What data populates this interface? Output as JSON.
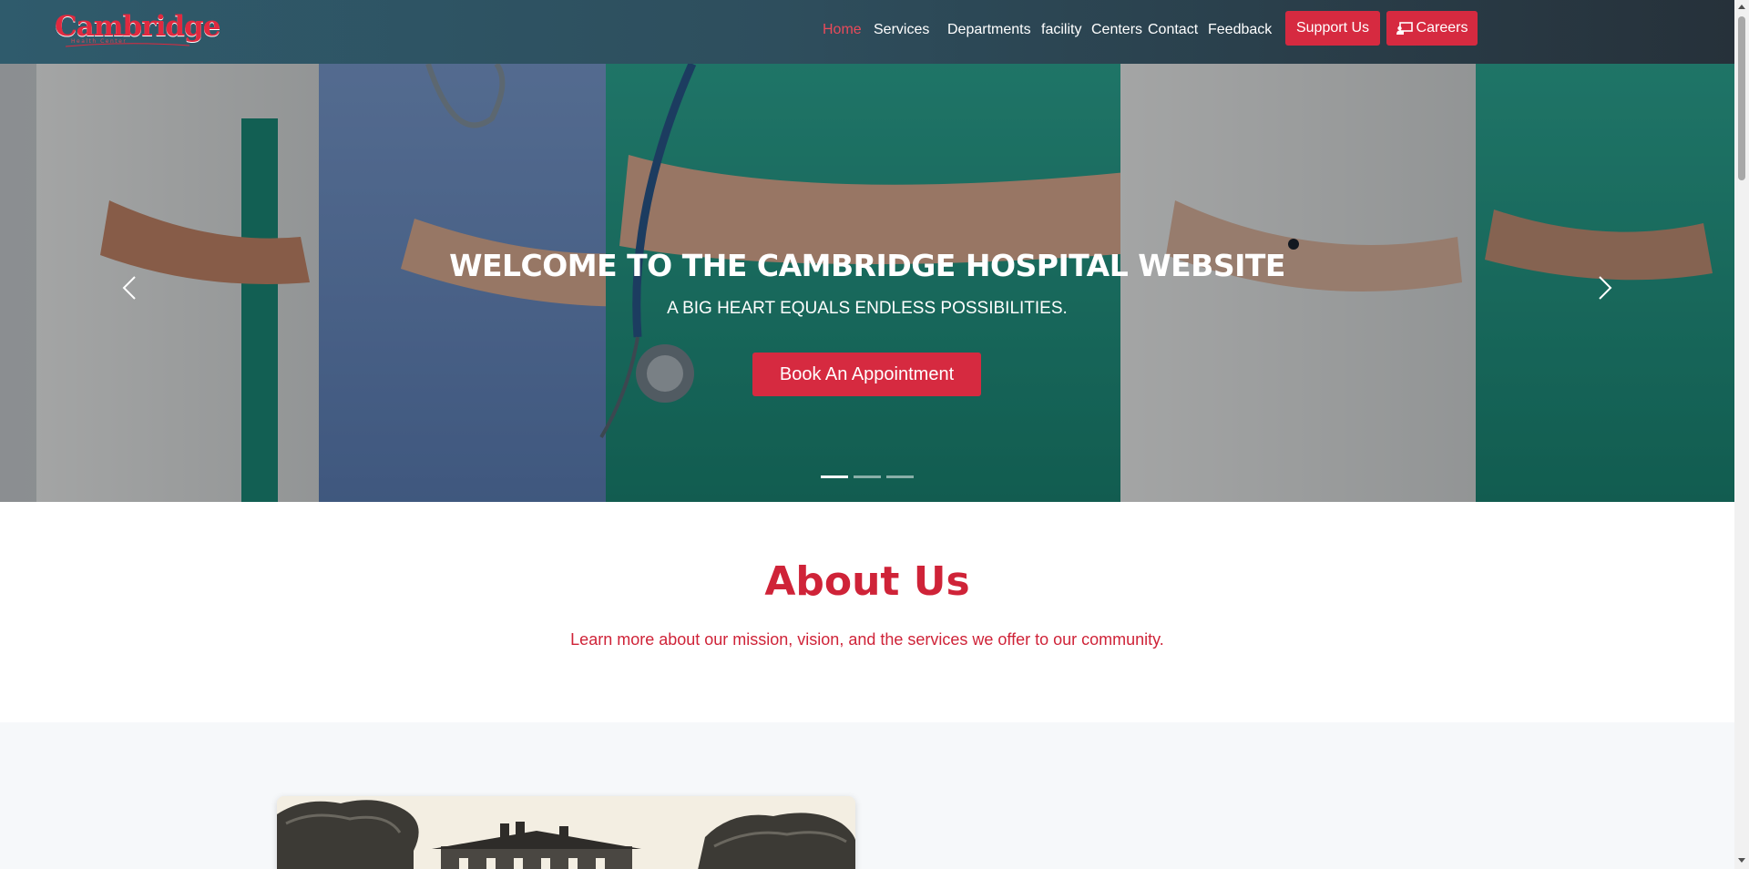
{
  "brand": {
    "logo_text": "Cambridge",
    "logo_subtext": "Health Center",
    "accent_color": "#d62a40",
    "nav_bg_color": "#2e4e5d"
  },
  "nav": {
    "items": [
      {
        "label": "Home",
        "active": true
      },
      {
        "label": "Services",
        "active": false
      },
      {
        "label": "Departments",
        "active": false
      },
      {
        "label": "facility",
        "active": false
      },
      {
        "label": "Centers",
        "active": false
      },
      {
        "label": "Contact",
        "active": false
      },
      {
        "label": "Feedback",
        "active": false
      }
    ],
    "support_label": "Support Us",
    "careers_label": "Careers",
    "careers_icon": "chalkboard-teacher-icon"
  },
  "hero": {
    "title": "WELCOME TO THE CAMBRIDGE HOSPITAL WEBSITE",
    "subtitle": "A BIG HEART EQUALS ENDLESS POSSIBILITIES.",
    "cta_label": "Book An Appointment",
    "prev_icon": "chevron-left-icon",
    "next_icon": "chevron-right-icon",
    "slide_count": 3,
    "active_slide": 1
  },
  "about": {
    "title": "About Us",
    "lead": "Learn more about our mission, vision, and the services we offer to our community."
  }
}
